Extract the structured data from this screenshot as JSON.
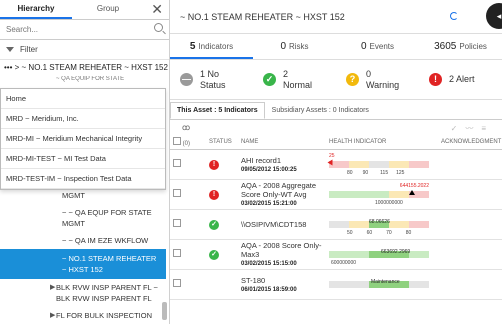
{
  "left": {
    "tabs": [
      "Hierarchy",
      "Group"
    ],
    "search_placeholder": "Search...",
    "filter_label": "Filter",
    "breadcrumb": "••• > ~ NO.1 STEAM REHEATER ~ HXST 152",
    "breadcrumb_sub": "~ QA EQUIP FOR STATE",
    "dropdown": [
      "Home",
      "MRD ~ Meridium, Inc.",
      "MRD-MI ~ Meridium Mechanical Integrity",
      "MRD-MI-TEST ~ MI Test Data",
      "MRD-TEST-IM ~ Inspection Test Data"
    ],
    "tree": [
      {
        "label": "~ ~ QA EQUP FOR STATE MGMT"
      },
      {
        "label": "~ ~ QA EQUP FOR STATE MGMT"
      },
      {
        "label": "~ ~ QA IM EZE WKFLOW"
      },
      {
        "label": "~ NO.1 STEAM REHEATER ~ HXST 152"
      },
      {
        "label": "BLK RVW INSP PARENT FL ~ BLK RVW INSP PARENT FL"
      },
      {
        "label": "FL FOR BULK INSPECTION REPORTS ~"
      }
    ]
  },
  "right": {
    "title": "~ NO.1 STEAM REHEATER ~ HXST 152",
    "counts": [
      {
        "num": "5",
        "label": "Indicators"
      },
      {
        "num": "0",
        "label": "Risks"
      },
      {
        "num": "0",
        "label": "Events"
      },
      {
        "num": "3605",
        "label": "Policies"
      }
    ],
    "statuses": [
      {
        "line1": "1 No",
        "line2": "Status",
        "color": "#9a9a9a",
        "symbol": "—"
      },
      {
        "line1": "2",
        "line2": "Normal",
        "color": "#39b54a",
        "symbol": "✓"
      },
      {
        "line1": "0",
        "line2": "Warning",
        "color": "#f2b90c",
        "symbol": "?"
      },
      {
        "line1": "2 Alert",
        "line2": "",
        "color": "#e02424",
        "symbol": "!"
      }
    ],
    "subtabs": [
      "This Asset : 5 Indicators",
      "Subsidiary Assets : 0 Indicators"
    ],
    "columns": [
      "(0)",
      "STATUS",
      "NAME",
      "HEALTH INDICATOR",
      "ACKNOWLEDGMENT"
    ],
    "rows": [
      {
        "name": "AHI record1",
        "date": "09/05/2012 15:00:25",
        "status": "alert"
      },
      {
        "name": "AQA - 2008 Aggregate Score Only-WT Avg",
        "date": "03/02/2015 15:21:00",
        "status": "alert"
      },
      {
        "name": "\\\\OSIPIVM\\CDT158",
        "date": "",
        "status": "normal"
      },
      {
        "name": "AQA - 2008 Score Only-Max3",
        "date": "03/02/2015 15:15:00",
        "status": "normal"
      },
      {
        "name": "ST-180",
        "date": "06/01/2015 18:59:00",
        "status": "none"
      }
    ],
    "health": {
      "r1_top": "25",
      "r1_ticks": [
        "80",
        "90",
        "115",
        "125"
      ],
      "r2_top": "644155.2022",
      "r2_tick": "1000000000",
      "r3_label": "68.06626",
      "r3_ticks": [
        "50",
        "60",
        "70",
        "80"
      ],
      "r4_label": "663692.2969",
      "r4_tick": "600000000",
      "r5_label": "Maintenance"
    }
  }
}
